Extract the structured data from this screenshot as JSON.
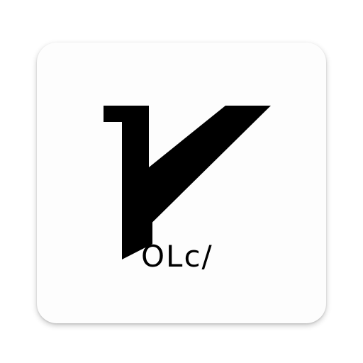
{
  "icon": {
    "name": "v2ray-logo-icon",
    "wordmark": "OLc/",
    "colors": {
      "tile": "#fdfdfd",
      "glyph": "#000000",
      "background": "#ffffff"
    }
  }
}
